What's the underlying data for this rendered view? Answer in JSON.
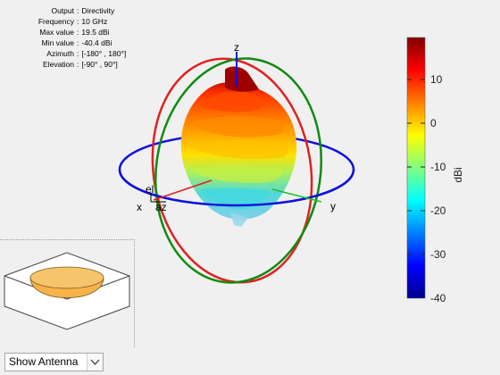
{
  "info": {
    "rows": [
      {
        "key": "Output",
        "value": "Directivity"
      },
      {
        "key": "Frequency",
        "value": "10 GHz"
      },
      {
        "key": "Max value",
        "value": "19.5 dBi"
      },
      {
        "key": "Min value",
        "value": "-40.4 dBi"
      },
      {
        "key": "Azimuth",
        "value": "[-180° , 180°]"
      },
      {
        "key": "Elevation",
        "value": "[-90° , 90°]"
      }
    ]
  },
  "axes": {
    "z_label": "z",
    "y_label": "y",
    "x_label": "x",
    "el_label": "el",
    "az_label": "az"
  },
  "colorbar": {
    "unit": "dBi",
    "ticks": [
      "10",
      "0",
      "-10",
      "-20",
      "-30",
      "-40"
    ]
  },
  "controls": {
    "view_select": "Show Antenna"
  },
  "colors": {
    "blue_ring": "#1010e0",
    "red_ring": "#e02020",
    "green_ring": "#108a10"
  }
}
